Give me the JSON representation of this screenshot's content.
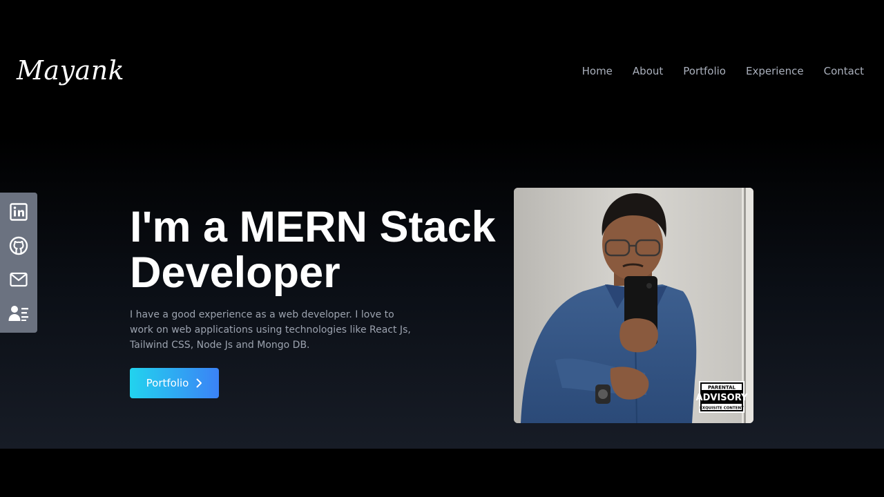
{
  "brand": {
    "name": "Mayank"
  },
  "nav": {
    "items": [
      "Home",
      "About",
      "Portfolio",
      "Experience",
      "Contact"
    ]
  },
  "social": {
    "icons": [
      "linkedin-icon",
      "github-icon",
      "mail-icon",
      "resume-icon"
    ]
  },
  "hero": {
    "line1": "I'm a MERN Stack",
    "line2": "Developer",
    "description": "I have a good experience as a web developer. I love to work on web applications using technologies like React Js, Tailwind CSS, Node Js and Mongo DB.",
    "button_label": "Portfolio"
  },
  "photo": {
    "badge_line1": "PARENTAL",
    "badge_line2": "ADVISORY",
    "badge_line3": "EXQUISITE CONTENT"
  },
  "colors": {
    "accent_start": "#22d3ee",
    "accent_end": "#3b82f6",
    "nav_text": "#aab0bc",
    "social_bar": "#6b7280"
  }
}
